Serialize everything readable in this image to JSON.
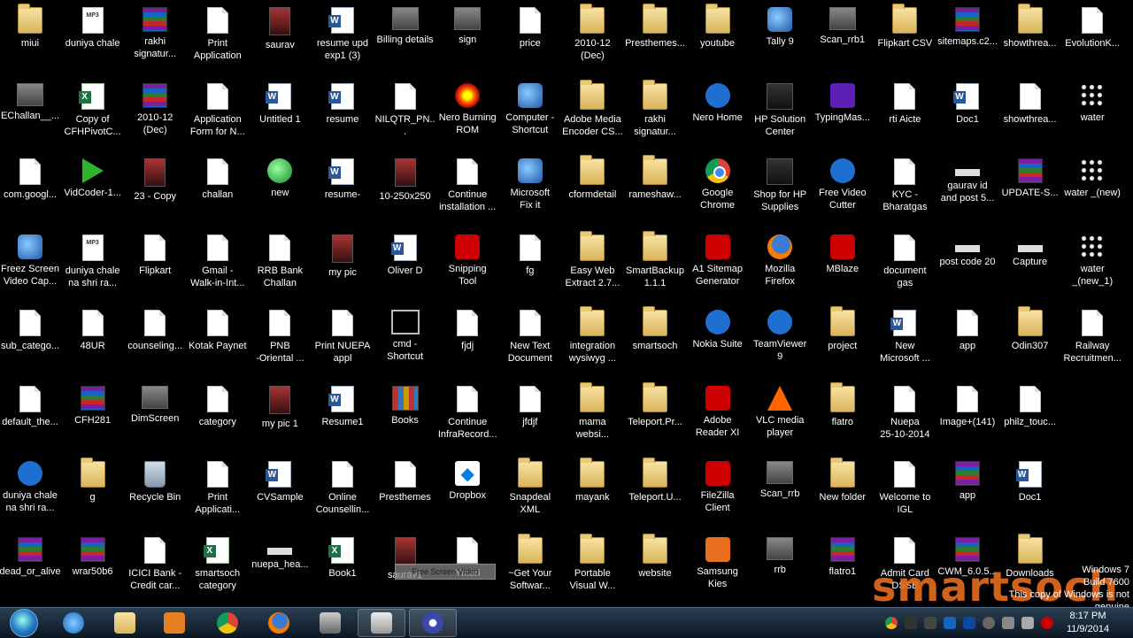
{
  "desktop": {
    "icons": [
      {
        "label": "miui",
        "type": "folder"
      },
      {
        "label": "duniya chale",
        "type": "mp3"
      },
      {
        "label": "rakhi\nsignatur...",
        "type": "rar"
      },
      {
        "label": "Print\nApplication",
        "type": "doc"
      },
      {
        "label": "saurav",
        "type": "photo"
      },
      {
        "label": "resume upd\nexp1 (3)",
        "type": "word"
      },
      {
        "label": "Billing details",
        "type": "image"
      },
      {
        "label": "sign",
        "type": "image"
      },
      {
        "label": "price",
        "type": "doc"
      },
      {
        "label": "2010-12\n(Dec)",
        "type": "folder"
      },
      {
        "label": "Presthemes...",
        "type": "folder"
      },
      {
        "label": "youtube",
        "type": "folder"
      },
      {
        "label": "Tally 9",
        "type": "app"
      },
      {
        "label": "Scan_rrb1",
        "type": "image"
      },
      {
        "label": "Flipkart CSV",
        "type": "folder"
      },
      {
        "label": "sitemaps.c2...",
        "type": "rar"
      },
      {
        "label": "showthrea...",
        "type": "folder"
      },
      {
        "label": "EvolutionK...",
        "type": "doc"
      },
      {
        "label": "EChallan__...",
        "type": "image"
      },
      {
        "label": "Copy of\nCFHPivotC...",
        "type": "excel"
      },
      {
        "label": "2010-12\n(Dec)",
        "type": "rar"
      },
      {
        "label": "Application\nForm for N...",
        "type": "doc"
      },
      {
        "label": "Untitled 1",
        "type": "word"
      },
      {
        "label": "resume",
        "type": "word"
      },
      {
        "label": "NILQTR_PN...",
        "type": "doc"
      },
      {
        "label": "Nero Burning\nROM",
        "type": "nero"
      },
      {
        "label": "Computer -\nShortcut",
        "type": "app"
      },
      {
        "label": "Adobe Media\nEncoder CS...",
        "type": "folder"
      },
      {
        "label": "rakhi\nsignatur...",
        "type": "folder"
      },
      {
        "label": "Nero Home",
        "type": "blue"
      },
      {
        "label": "HP Solution\nCenter",
        "type": "dark"
      },
      {
        "label": "TypingMas...",
        "type": "purple"
      },
      {
        "label": "rti Aicte",
        "type": "doc"
      },
      {
        "label": "Doc1",
        "type": "word"
      },
      {
        "label": "showthrea...",
        "type": "doc"
      },
      {
        "label": "water",
        "type": "drops"
      },
      {
        "label": "com.googl...",
        "type": "doc"
      },
      {
        "label": "VidCoder-1...",
        "type": "vid"
      },
      {
        "label": "23 - Copy",
        "type": "photo"
      },
      {
        "label": "challan",
        "type": "doc"
      },
      {
        "label": "new",
        "type": "green"
      },
      {
        "label": "resume-",
        "type": "word"
      },
      {
        "label": "10-250x250",
        "type": "photo"
      },
      {
        "label": "Continue\ninstallation ...",
        "type": "doc"
      },
      {
        "label": "Microsoft\nFix it",
        "type": "app"
      },
      {
        "label": "cformdetail",
        "type": "folder"
      },
      {
        "label": "rameshaw...",
        "type": "folder"
      },
      {
        "label": "Google\nChrome",
        "type": "chrome"
      },
      {
        "label": "Shop for HP\nSupplies",
        "type": "dark"
      },
      {
        "label": "Free Video\nCutter",
        "type": "blue"
      },
      {
        "label": "KYC -\nBharatgas",
        "type": "doc"
      },
      {
        "label": "gaurav  id\nand post 5...",
        "type": "strip"
      },
      {
        "label": "UPDATE-S...",
        "type": "rar"
      },
      {
        "label": "water _(new)",
        "type": "drops"
      },
      {
        "label": "Freez Screen\nVideo Cap...",
        "type": "app"
      },
      {
        "label": "duniya chale\nna shri ra...",
        "type": "mp3"
      },
      {
        "label": "Flipkart",
        "type": "doc"
      },
      {
        "label": "Gmail -\nWalk-in-Int...",
        "type": "doc"
      },
      {
        "label": "RRB Bank\nChallan",
        "type": "doc"
      },
      {
        "label": "my pic",
        "type": "photo"
      },
      {
        "label": "Oliver D",
        "type": "word"
      },
      {
        "label": "Snipping\nTool",
        "type": "red"
      },
      {
        "label": "fg",
        "type": "doc"
      },
      {
        "label": "Easy Web\nExtract 2.7...",
        "type": "folder"
      },
      {
        "label": "SmartBackup\n1.1.1",
        "type": "folder"
      },
      {
        "label": "A1 Sitemap\nGenerator",
        "type": "red"
      },
      {
        "label": "Mozilla\nFirefox",
        "type": "firefox"
      },
      {
        "label": "MBlaze",
        "type": "red"
      },
      {
        "label": "document\ngas",
        "type": "doc"
      },
      {
        "label": "post code 20",
        "type": "strip"
      },
      {
        "label": "Capture",
        "type": "strip"
      },
      {
        "label": "water\n_(new_1)",
        "type": "drops"
      },
      {
        "label": "sub_catego...",
        "type": "doc"
      },
      {
        "label": "48UR",
        "type": "doc"
      },
      {
        "label": "counseling...",
        "type": "doc"
      },
      {
        "label": "Kotak Paynet",
        "type": "doc"
      },
      {
        "label": "PNB\n-Oriental ...",
        "type": "doc"
      },
      {
        "label": "Print NUEPA\nappl",
        "type": "doc"
      },
      {
        "label": "cmd -\nShortcut",
        "type": "cmd"
      },
      {
        "label": "fjdj",
        "type": "doc"
      },
      {
        "label": "New Text\nDocument",
        "type": "doc"
      },
      {
        "label": "integration\nwysiwyg ...",
        "type": "folder"
      },
      {
        "label": "smartsoch",
        "type": "folder"
      },
      {
        "label": "Nokia Suite",
        "type": "blue"
      },
      {
        "label": "TeamViewer\n9",
        "type": "blue"
      },
      {
        "label": "project",
        "type": "folder"
      },
      {
        "label": "New\nMicrosoft ...",
        "type": "word"
      },
      {
        "label": "app",
        "type": "doc"
      },
      {
        "label": "Odin307",
        "type": "folder"
      },
      {
        "label": "Railway\nRecruitmen...",
        "type": "doc"
      },
      {
        "label": "default_the...",
        "type": "doc"
      },
      {
        "label": "CFH281",
        "type": "rar"
      },
      {
        "label": "DimScreen",
        "type": "image"
      },
      {
        "label": "category",
        "type": "doc"
      },
      {
        "label": "my pic 1",
        "type": "photo"
      },
      {
        "label": "Resume1",
        "type": "word"
      },
      {
        "label": "Books",
        "type": "books"
      },
      {
        "label": "Continue\nInfraRecord...",
        "type": "doc"
      },
      {
        "label": "jfdjf",
        "type": "doc"
      },
      {
        "label": "mama\nwebsi...",
        "type": "folder"
      },
      {
        "label": "Teleport.Pr...",
        "type": "folder"
      },
      {
        "label": "Adobe\nReader XI",
        "type": "red"
      },
      {
        "label": "VLC media\nplayer",
        "type": "vlc"
      },
      {
        "label": "flatro",
        "type": "folder"
      },
      {
        "label": "Nuepa\n25-10-2014",
        "type": "doc"
      },
      {
        "label": "Image+(141)",
        "type": "doc"
      },
      {
        "label": "philz_touc...",
        "type": "doc"
      },
      {
        "label": "duniya chale\nna shri ra...",
        "type": "blue"
      },
      {
        "label": "g",
        "type": "folder"
      },
      {
        "label": "Recycle Bin",
        "type": "recycle"
      },
      {
        "label": "Print\nApplicati...",
        "type": "doc"
      },
      {
        "label": "CVSample",
        "type": "word"
      },
      {
        "label": "Online\nCounsellin...",
        "type": "doc"
      },
      {
        "label": "Presthemes",
        "type": "doc"
      },
      {
        "label": "Dropbox",
        "type": "dropbox"
      },
      {
        "label": "Snapdeal\nXML",
        "type": "folder"
      },
      {
        "label": "mayank",
        "type": "folder"
      },
      {
        "label": "Teleport.U...",
        "type": "folder"
      },
      {
        "label": "FileZilla\nClient",
        "type": "red"
      },
      {
        "label": "Scan_rrb",
        "type": "image"
      },
      {
        "label": "New folder",
        "type": "folder"
      },
      {
        "label": "Welcome to\nIGL",
        "type": "doc"
      },
      {
        "label": "app",
        "type": "rar"
      },
      {
        "label": "Doc1",
        "type": "word"
      },
      {
        "label": "dead_or_alive",
        "type": "rar"
      },
      {
        "label": "wrar50b6",
        "type": "rar"
      },
      {
        "label": "ICICI Bank -\nCredit car...",
        "type": "doc"
      },
      {
        "label": "smartsoch\ncategory",
        "type": "excel"
      },
      {
        "label": "nuepa_hea...",
        "type": "strip"
      },
      {
        "label": "Book1",
        "type": "excel"
      },
      {
        "label": "saurav1",
        "type": "photo"
      },
      {
        "label": "Ymeri",
        "type": "doc"
      },
      {
        "label": "~Get Your\nSoftwar...",
        "type": "folder"
      },
      {
        "label": "Portable\nVisual W...",
        "type": "folder"
      },
      {
        "label": "website",
        "type": "folder"
      },
      {
        "label": "Samsung\nKies",
        "type": "orange"
      },
      {
        "label": "rrb",
        "type": "image"
      },
      {
        "label": "flatro1",
        "type": "rar"
      },
      {
        "label": "Admit Card\nDSSB",
        "type": "doc"
      },
      {
        "label": "CWM_6.0.5...",
        "type": "rar"
      },
      {
        "label": "Downloads",
        "type": "folder"
      }
    ],
    "drag_ghost_text": "Free Screen Video"
  },
  "taskbar": {
    "pinned": [
      {
        "name": "start-button",
        "color": "#2a7fc9"
      },
      {
        "name": "internet-explorer-icon",
        "color": "#1e88e5"
      },
      {
        "name": "file-explorer-icon",
        "color": "#e3b64d"
      },
      {
        "name": "media-player-icon",
        "color": "#e67e22"
      },
      {
        "name": "chrome-icon",
        "color": "#db4437"
      },
      {
        "name": "firefox-icon",
        "color": "#f57c00"
      },
      {
        "name": "blank-window-icon",
        "color": "#777777"
      },
      {
        "name": "camera-icon",
        "color": "#cccccc"
      },
      {
        "name": "media-app-icon",
        "color": "#3949ab"
      }
    ],
    "clock": {
      "time": "8:17 PM",
      "date": "11/9/2014"
    }
  },
  "watermark": {
    "line1": "Windows 7",
    "line2": "Build 7600",
    "line3": "This copy of Windows is not genuine",
    "brand": "smartsoch"
  }
}
